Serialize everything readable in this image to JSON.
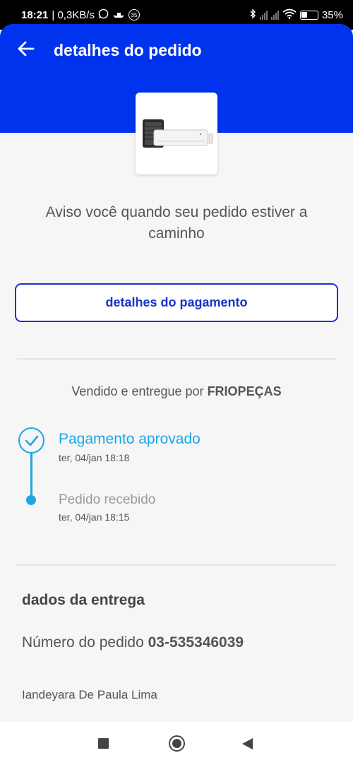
{
  "status_bar": {
    "time": "18:21",
    "speed": "| 0,3KB/s",
    "badge": "35",
    "battery_text": "35%",
    "battery_level": 0.35,
    "icons": [
      "whatsapp-icon",
      "boat-icon",
      "notification-badge-icon",
      "bluetooth-icon",
      "signal-icon",
      "signal-icon",
      "wifi-icon",
      "battery-icon"
    ]
  },
  "header": {
    "title": "detalhes do pedido",
    "back_icon": "arrow-left-icon",
    "background": "#0033ee"
  },
  "product": {
    "image_icon": "air-conditioner-image"
  },
  "notice": "Aviso você quando seu pedido estiver a caminho",
  "payment_button": {
    "label": "detalhes do pagamento",
    "color": "#1a34c8"
  },
  "seller": {
    "prefix": "Vendido e entregue por ",
    "name": "FRIOPEÇAS"
  },
  "timeline": {
    "accent": "#1ea6e6",
    "steps": [
      {
        "title": "Pagamento aprovado",
        "date": "ter, 04/jan 18:18",
        "icon": "check-circle-icon"
      },
      {
        "title": "Pedido recebido",
        "date": "ter, 04/jan 18:15",
        "icon": "dot-icon"
      }
    ]
  },
  "delivery": {
    "heading": "dados da entrega",
    "order_label": "Número do pedido ",
    "order_number": "03-535346039",
    "recipient": "Iandeyara De Paula Lima"
  },
  "nav_bar": {
    "icons": [
      "recent-apps-icon",
      "home-icon",
      "back-icon"
    ]
  }
}
